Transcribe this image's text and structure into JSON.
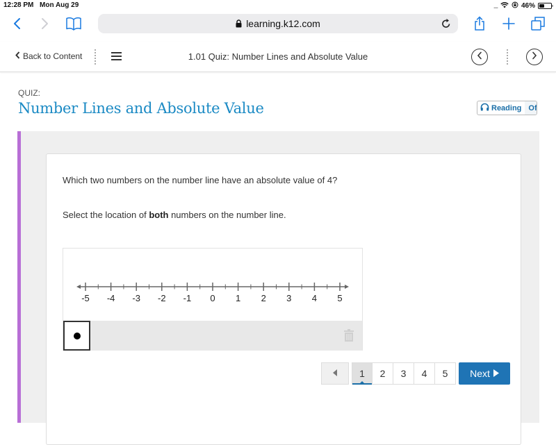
{
  "status_bar": {
    "time": "12:28 PM",
    "date": "Mon Aug 29",
    "signal_dots": "....",
    "battery_percent": "46%",
    "battery_level": 0.46
  },
  "browser": {
    "url": "learning.k12.com",
    "icons": [
      "back-icon",
      "forward-icon",
      "bookmarks-icon",
      "lock-icon",
      "reload-icon",
      "share-icon",
      "new-tab-icon",
      "tabs-icon"
    ]
  },
  "app_nav": {
    "back_label": "Back to Content",
    "title": "1.01 Quiz: Number Lines and Absolute Value"
  },
  "quiz": {
    "label": "QUIZ:",
    "title": "Number Lines and Absolute Value",
    "reading": {
      "label": "Reading",
      "state": "Off"
    }
  },
  "question": {
    "prompt": "Which two numbers on the number line have an absolute value of 4?",
    "instruction_pre": "Select the location of ",
    "instruction_bold": "both",
    "instruction_post": " numbers on the number line."
  },
  "number_line": {
    "min": -5,
    "max": 5,
    "major_step": 1,
    "minor_step": 0.5,
    "labels": [
      "-5",
      "-4",
      "-3",
      "-2",
      "-1",
      "0",
      "1",
      "2",
      "3",
      "4",
      "5"
    ],
    "plotted_points": []
  },
  "tools": {
    "point_tool": "point-tool",
    "delete": "trash-icon"
  },
  "pagination": {
    "pages": [
      "1",
      "2",
      "3",
      "4",
      "5"
    ],
    "current": "1",
    "next_label": "Next"
  },
  "colors": {
    "title_blue": "#1b8ac4",
    "accent_purple": "#b86fd6",
    "next_button": "#1f74b5",
    "ios_blue": "#1a7ae0"
  }
}
